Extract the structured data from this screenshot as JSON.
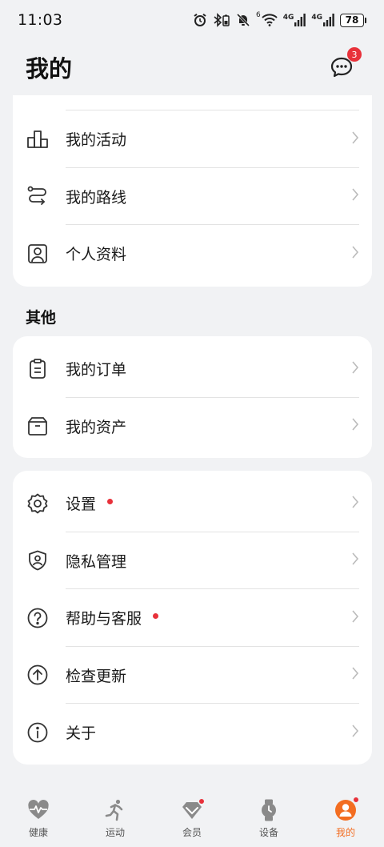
{
  "status_bar": {
    "time": "11:03",
    "signal1_label": "4G",
    "signal2_label": "4G",
    "wifi_sup": "6",
    "battery": "78"
  },
  "header": {
    "title": "我的",
    "message_badge": "3"
  },
  "card1": {
    "items": [
      {
        "label": "我的活动",
        "icon": "activity-podium-icon"
      },
      {
        "label": "我的路线",
        "icon": "route-icon"
      },
      {
        "label": "个人资料",
        "icon": "profile-icon"
      }
    ]
  },
  "section_other": {
    "title": "其他"
  },
  "card2": {
    "items": [
      {
        "label": "我的订单",
        "icon": "order-clipboard-icon"
      },
      {
        "label": "我的资产",
        "icon": "assets-box-icon"
      }
    ]
  },
  "card3": {
    "items": [
      {
        "label": "设置",
        "icon": "gear-icon",
        "dot": true
      },
      {
        "label": "隐私管理",
        "icon": "privacy-shield-icon",
        "dot": false
      },
      {
        "label": "帮助与客服",
        "icon": "help-icon",
        "dot": true
      },
      {
        "label": "检查更新",
        "icon": "update-arrow-icon",
        "dot": false
      },
      {
        "label": "关于",
        "icon": "info-icon",
        "dot": false
      }
    ]
  },
  "bottom_nav": {
    "items": [
      {
        "label": "健康",
        "icon": "health-heart-icon"
      },
      {
        "label": "运动",
        "icon": "running-icon"
      },
      {
        "label": "会员",
        "icon": "member-gem-icon"
      },
      {
        "label": "设备",
        "icon": "watch-icon"
      },
      {
        "label": "我的",
        "icon": "me-avatar-icon",
        "active": true
      }
    ]
  },
  "colors": {
    "accent": "#f36d21",
    "badge": "#e8313a",
    "background": "#f1f2f4"
  }
}
